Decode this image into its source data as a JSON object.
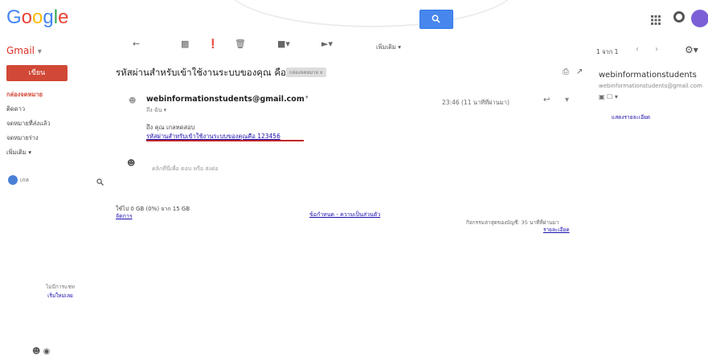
{
  "header": {
    "logo_text": "Google",
    "search_icon": "search-icon",
    "apps_icon": "apps-grid-icon"
  },
  "sidebar": {
    "gmail_label": "Gmail",
    "gmail_caret": "▾",
    "compose_label": "เขียน",
    "items": [
      {
        "label": "กล่องจดหมาย"
      },
      {
        "label": "ติดดาว"
      },
      {
        "label": "จดหมายที่ส่งแล้ว"
      },
      {
        "label": "จดหมายร่าง"
      },
      {
        "label": "เพิ่มเติม ▾"
      }
    ],
    "user_name": "เกล",
    "no_chats": "ไม่มีการแชท",
    "start_new": "เริ่มใหม่เลย"
  },
  "toolbar": {
    "more_label": "เพิ่มเติม ▾",
    "pager_text": "1 จาก 1",
    "prev": "‹",
    "next": "›"
  },
  "message": {
    "subject": "รหัสผ่านสำหรับเข้าใช้งานระบบของคุณ คือ",
    "inbox_badge": "กล่องจดหมาย x",
    "sender_email": "webinformationstudents@gmail.com",
    "to_line": "ถึง ฉัน ▾",
    "datetime": "23:46 (11 นาทีที่ผ่านมา)",
    "body_greeting": "ถึง คุณ เกลทดสอบ",
    "body_code": "รหัสผ่านสำหรับเข้าใช้งานระบบของคุณคือ 123456",
    "reply_prompt": "คลิกที่นี่เพื่อ ตอบ หรือ ส่งต่อ"
  },
  "footer": {
    "storage": "ใช้ไป 0 GB (0%) จาก 15 GB",
    "manage": "จัดการ",
    "terms": "ข้อกำหนด - ความเป็นส่วนตัว",
    "activity": "กิจกรรมล่าสุดของบัญชี: 35 นาทีที่ผ่านมา",
    "details": "รายละเอียด"
  },
  "right_panel": {
    "name": "webinformationstudents",
    "email": "webinformationstudents@gmail.com",
    "icons": "▣ ☐ ▾",
    "more_info": "แสดงรายละเอียด"
  }
}
